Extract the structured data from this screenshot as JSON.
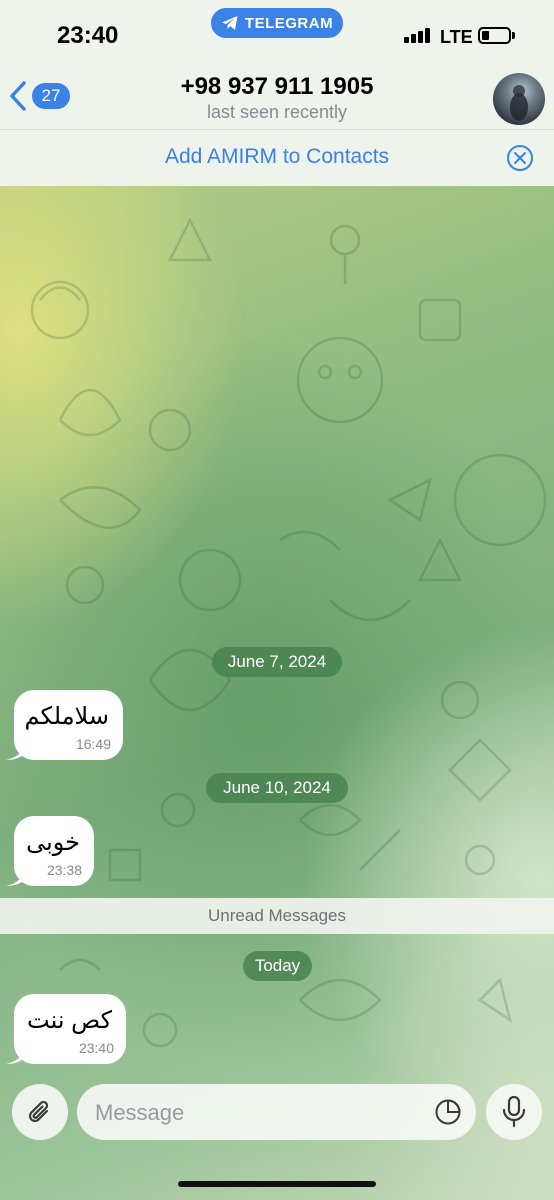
{
  "status_bar": {
    "time": "23:40",
    "app_pill": "TELEGRAM",
    "network": "LTE"
  },
  "header": {
    "back_count": "27",
    "title": "+98 937 911 1905",
    "subtitle": "last seen recently",
    "add_contacts": "Add AMIRM to Contacts"
  },
  "messages": [
    {
      "date": "June 7, 2024",
      "text": "سلاملکم",
      "time": "16:49"
    },
    {
      "date": "June 10, 2024",
      "text": "خوبی",
      "time": "23:38"
    },
    {
      "date": "Today",
      "text": "کص ننت",
      "time": "23:40"
    }
  ],
  "unread_label": "Unread Messages",
  "composer": {
    "placeholder": "Message"
  },
  "colors": {
    "accent": "#3b82e8",
    "date_pill": "#4a8250",
    "bubble": "#ffffff"
  },
  "icons": [
    "telegram-icon",
    "back-chevron-icon",
    "close-circle-icon",
    "paperclip-icon",
    "sticker-icon",
    "microphone-icon"
  ]
}
